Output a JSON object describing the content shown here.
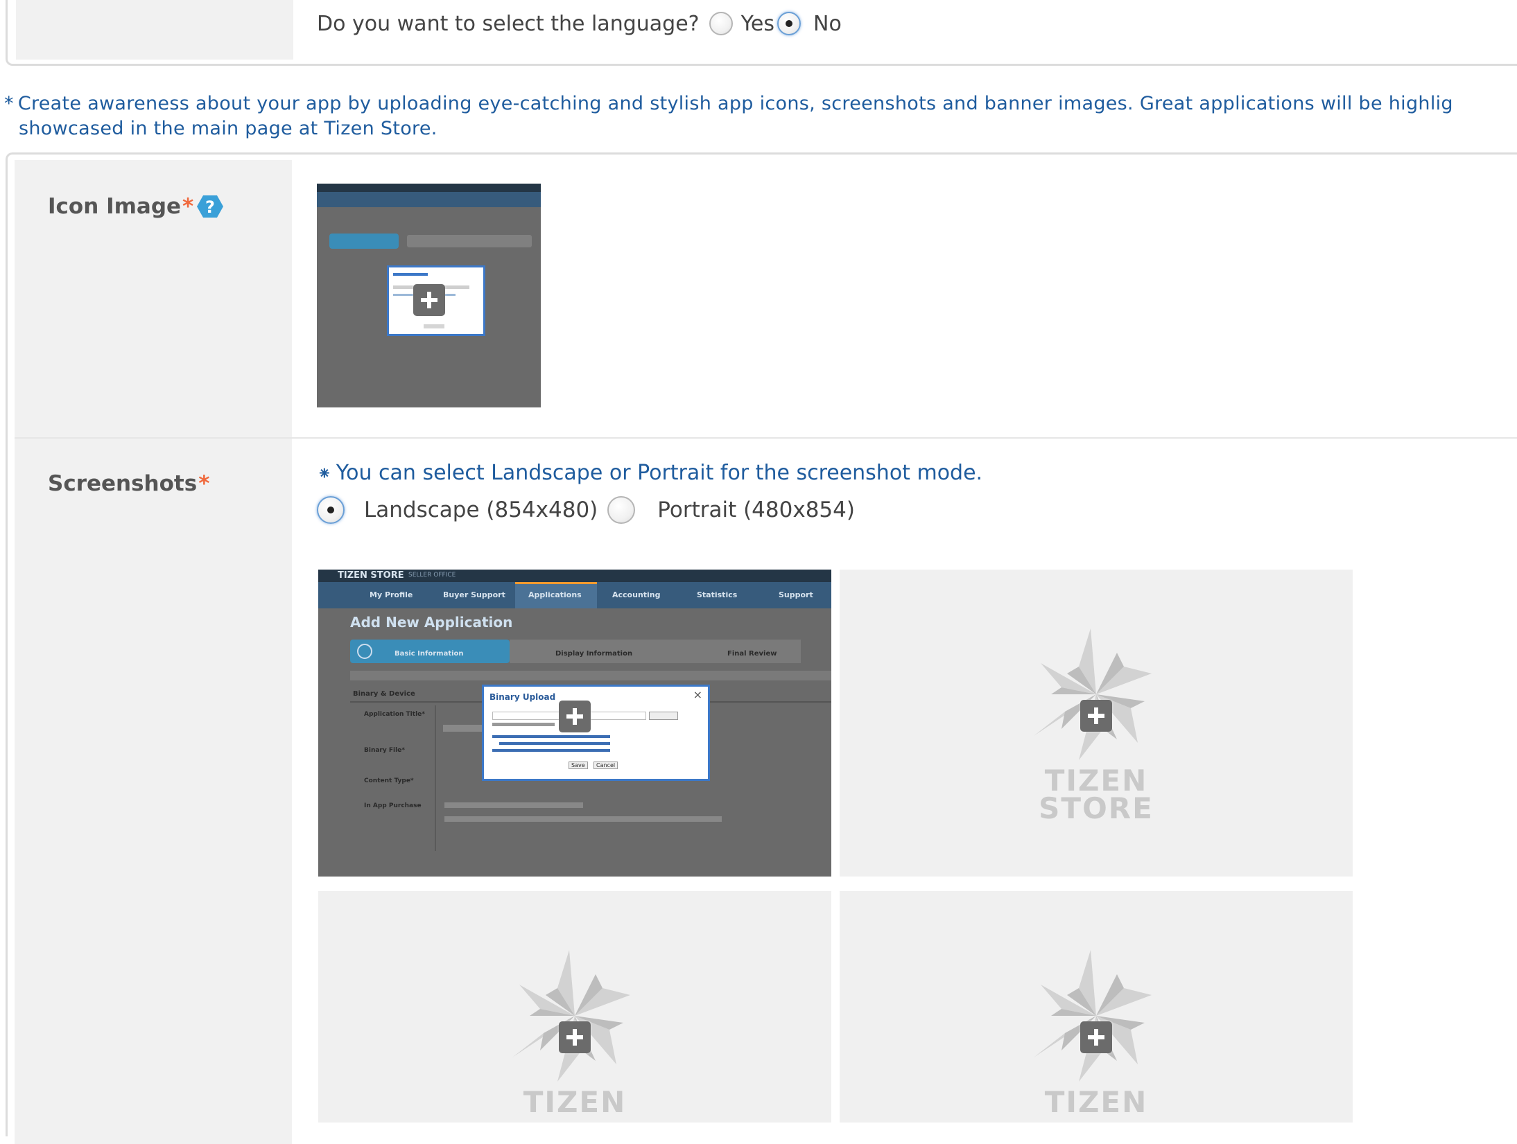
{
  "language": {
    "question": "Do you want to select the language?",
    "options": [
      {
        "label": "Yes",
        "selected": false
      },
      {
        "label": "No",
        "selected": true
      }
    ]
  },
  "notice": {
    "star": "*",
    "line1": "Create awareness about your app by uploading eye-catching and stylish app icons, screenshots and banner images. Great applications will be highlig",
    "line2": "showcased in the main page at Tizen Store."
  },
  "icon_image": {
    "label": "Icon Image",
    "required_mark": "*",
    "help_icon": "question-icon"
  },
  "screenshots": {
    "label": "Screenshots",
    "required_mark": "*",
    "note_star": "⁕",
    "note": "You can select Landscape or Portrait for the screenshot mode.",
    "modes": [
      {
        "label": "Landscape (854x480)",
        "selected": true
      },
      {
        "label": "Portrait (480x854)",
        "selected": false
      }
    ],
    "placeholder_brand_1": "TIZEN",
    "placeholder_brand_2": "STORE"
  },
  "mini_screenshot": {
    "brand": "TIZEN STORE",
    "brand_sub": "SELLER OFFICE",
    "nav": [
      "My Profile",
      "Buyer Support",
      "Applications",
      "Accounting",
      "Statistics",
      "Support"
    ],
    "page_title": "Add New Application",
    "steps": [
      "Basic Information",
      "Display Information",
      "Final Review"
    ],
    "dialog_title": "Binary Upload",
    "fields": [
      "Application Title*",
      "Binary File*",
      "Content Type*",
      "In App Purchase"
    ],
    "section": "Binary & Device",
    "dialog_buttons": [
      "Save",
      "Cancel"
    ]
  },
  "colors": {
    "accent_text": "#1f5c9e",
    "required": "#f06a3e",
    "label_bg": "#f1f1f1",
    "help_icon": "#3aa0d8"
  }
}
